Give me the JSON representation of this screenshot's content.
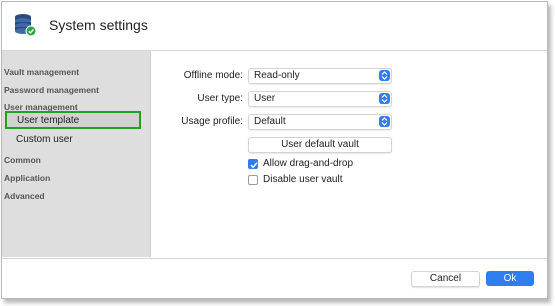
{
  "window": {
    "title": "System settings"
  },
  "sidebar": {
    "items": [
      {
        "label": "Vault management"
      },
      {
        "label": "Password management"
      },
      {
        "label": "User management"
      },
      {
        "label": "User template",
        "selected": true
      },
      {
        "label": "Custom user"
      },
      {
        "label": "Common"
      },
      {
        "label": "Application"
      },
      {
        "label": "Advanced"
      }
    ]
  },
  "form": {
    "offline_mode": {
      "label": "Offline mode:",
      "value": "Read-only"
    },
    "user_type": {
      "label": "User type:",
      "value": "User"
    },
    "usage_profile": {
      "label": "Usage profile:",
      "value": "Default"
    },
    "user_default_vault_button": "User default vault",
    "allow_drag_drop": {
      "label": "Allow drag-and-drop",
      "checked": true
    },
    "disable_user_vault": {
      "label": "Disable user vault",
      "checked": false
    }
  },
  "footer": {
    "cancel_label": "Cancel",
    "ok_label": "Ok"
  },
  "colors": {
    "accent": "#2f7ef0",
    "selection_outline": "#21a121",
    "sidebar_bg": "#dedede"
  },
  "icons": {
    "app": "database-check-icon",
    "dropdown": "up-down-chevron-icon",
    "check": "checkmark-icon"
  }
}
